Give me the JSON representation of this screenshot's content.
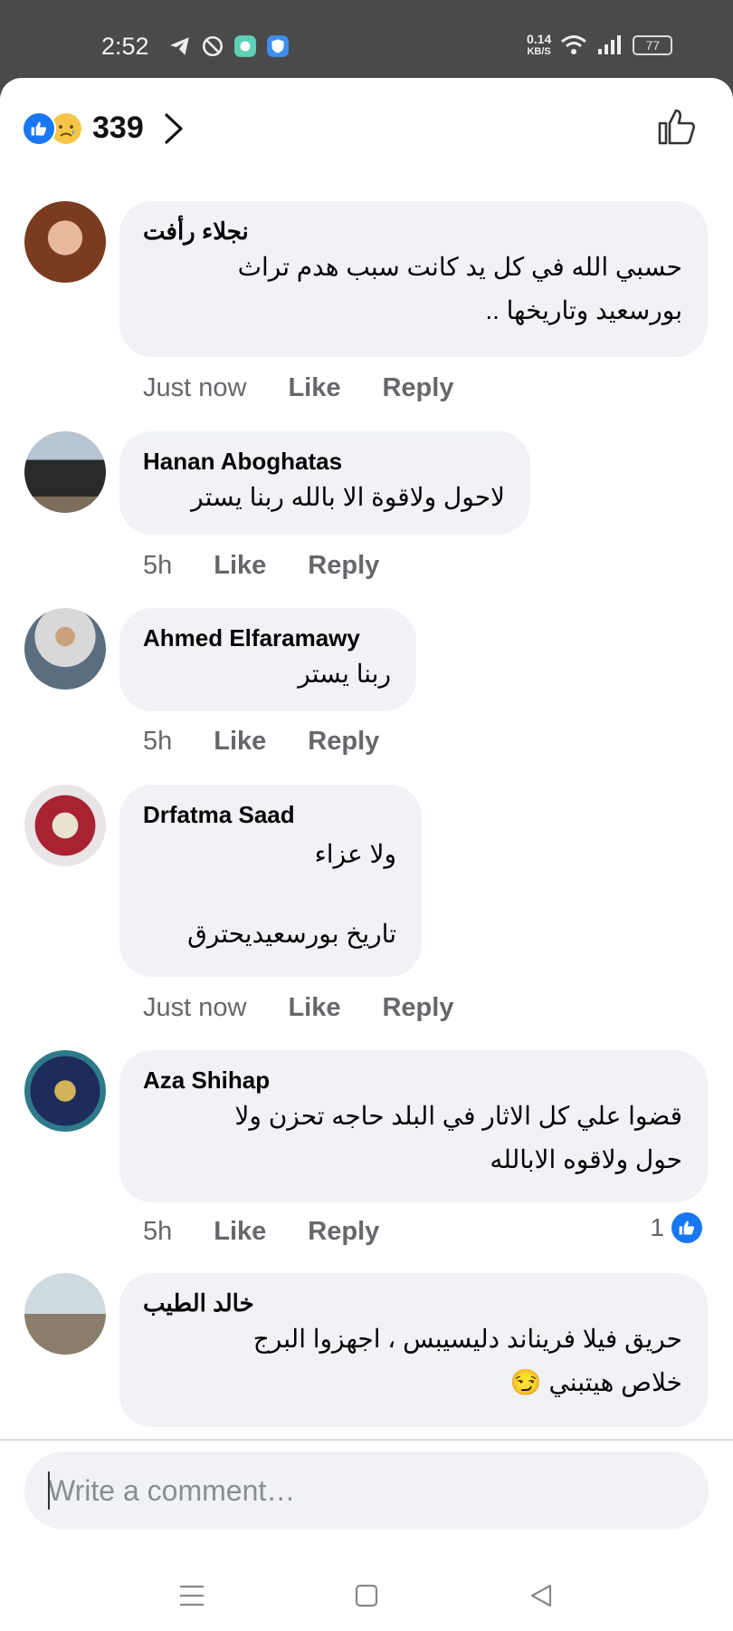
{
  "status": {
    "time": "2:52",
    "net_speed_value": "0.14",
    "net_speed_unit": "KB/S",
    "battery": "77"
  },
  "reactions": {
    "count": "339",
    "icons": [
      "like-reaction-icon",
      "sad-reaction-icon"
    ]
  },
  "comments": [
    {
      "author": "نجلاء رأفت",
      "text": "حسبي الله في كل يد كانت سبب هدم تراث\nبورسعيد وتاريخها ..",
      "time": "Just now",
      "like": "Like",
      "reply": "Reply"
    },
    {
      "author": "Hanan Aboghatas",
      "text": "لاحول ولاقوة الا بالله ربنا يستر",
      "time": "5h",
      "like": "Like",
      "reply": "Reply"
    },
    {
      "author": "Ahmed Elfaramawy",
      "text": "ربنا يستر",
      "time": "5h",
      "like": "Like",
      "reply": "Reply"
    },
    {
      "author": "Drfatma Saad",
      "text": "ولا عزاء\n\nتاريخ بورسعيديحترق",
      "time": "Just now",
      "like": "Like",
      "reply": "Reply"
    },
    {
      "author": "Aza Shihap",
      "text": "قضوا علي كل الاثار في البلد حاجه تحزن ولا\nحول ولاقوه الابالله",
      "time": "5h",
      "like": "Like",
      "reply": "Reply",
      "reaction_count": "1"
    },
    {
      "author": "خالد الطيب",
      "text": "حريق فيلا فريناند دليسيبس ، اجهزوا البرج\nخلاص هيتبني 😏",
      "time": "",
      "like": "",
      "reply": ""
    }
  ],
  "composer": {
    "placeholder": "Write a comment…"
  },
  "colors": {
    "accent": "#1877f2",
    "bubble": "#f0f2f5",
    "meta_text": "#65676b"
  }
}
